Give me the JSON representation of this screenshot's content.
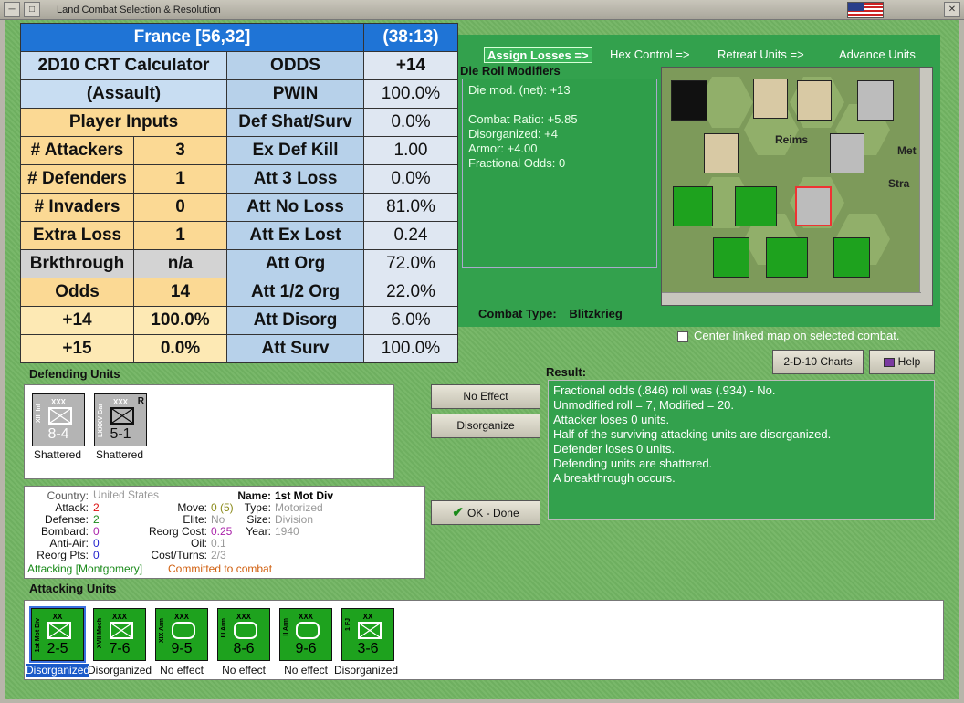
{
  "window": {
    "title": "Land Combat Selection & Resolution"
  },
  "crt": {
    "header_left": "France [56,32]",
    "header_right": "(38:13)",
    "calc_title": "2D10 CRT Calculator",
    "calc_sub": "(Assault)",
    "player_inputs": "Player Inputs",
    "rows_left": [
      {
        "label": "# Attackers",
        "value": "3"
      },
      {
        "label": "# Defenders",
        "value": "1"
      },
      {
        "label": "# Invaders",
        "value": "0"
      },
      {
        "label": "Extra Loss",
        "value": "1"
      },
      {
        "label": "Brkthrough",
        "value": "n/a"
      },
      {
        "label": "Odds",
        "value": "14"
      },
      {
        "label": "+14",
        "value": "100.0%"
      },
      {
        "label": "+15",
        "value": "0.0%"
      }
    ],
    "rows_right": [
      {
        "label": "ODDS",
        "value": "+14"
      },
      {
        "label": "PWIN",
        "value": "100.0%"
      },
      {
        "label": "Def Shat/Surv",
        "value": "0.0%"
      },
      {
        "label": "Ex Def Kill",
        "value": "1.00"
      },
      {
        "label": "Att 3 Loss",
        "value": "0.0%"
      },
      {
        "label": "Att No Loss",
        "value": "81.0%"
      },
      {
        "label": "Att Ex Lost",
        "value": "0.24"
      },
      {
        "label": "Att Org",
        "value": "72.0%"
      },
      {
        "label": "Att 1/2 Org",
        "value": "22.0%"
      },
      {
        "label": "Att Disorg",
        "value": "6.0%"
      },
      {
        "label": "Att Surv",
        "value": "100.0%"
      }
    ]
  },
  "steps": [
    "Assign Losses =>",
    "Hex Control =>",
    "Retreat Units =>",
    "Advance Units"
  ],
  "drm": {
    "title": "Die Roll Modifiers",
    "lines": [
      "Die mod. (net): +13",
      "",
      "Combat Ratio: +5.85",
      "Disorganized: +4",
      "Armor: +4.00",
      "Fractional Odds: 0"
    ]
  },
  "combat_type": {
    "label": "Combat Type:",
    "value": "Blitzkrieg"
  },
  "map": {
    "cities": [
      "Reims",
      "Met",
      "Stra"
    ]
  },
  "center_map_label": "Center linked map on selected combat.",
  "buttons": {
    "charts": "2-D-10 Charts",
    "help": "Help",
    "no_effect": "No Effect",
    "disorganize": "Disorganize",
    "ok_done": "OK - Done"
  },
  "defending": {
    "title": "Defending Units",
    "units": [
      {
        "size": "XXX",
        "name": "XIII Inf",
        "str": "8-4",
        "status": "Shattered"
      },
      {
        "size": "XXX",
        "name": "LXXXV Gar",
        "str": "5-1",
        "status": "Shattered",
        "tag": "R"
      }
    ]
  },
  "info": {
    "country_l": "Country:",
    "country_v": "United States",
    "attack_l": "Attack:",
    "attack_v": "2",
    "defense_l": "Defense:",
    "defense_v": "2",
    "bombard_l": "Bombard:",
    "bombard_v": "0",
    "antiair_l": "Anti-Air:",
    "antiair_v": "0",
    "reorg_l": "Reorg Pts:",
    "reorg_v": "0",
    "name_l": "Name:",
    "name_v": "1st Mot Div",
    "move_l": "Move:",
    "move_v": "0 (5)",
    "type_l": "Type:",
    "type_v": "Motorized",
    "elite_l": "Elite:",
    "elite_v": "No",
    "size_l": "Size:",
    "size_v": "Division",
    "reorgcost_l": "Reorg Cost:",
    "reorgcost_v": "0.25",
    "year_l": "Year:",
    "year_v": "1940",
    "oil_l": "Oil:",
    "oil_v": "0.1",
    "cost_l": "Cost/Turns:",
    "cost_v": "2/3",
    "status_a": "Attacking [Montgomery]",
    "status_b": "Committed to combat"
  },
  "result": {
    "title": "Result:",
    "lines": [
      "Fractional odds (.846) roll was (.934)  - No.",
      "Unmodified roll = 7, Modified = 20.",
      "Attacker loses 0 units.",
      "Half of the surviving attacking units are disorganized.",
      "Defender loses 0 units.",
      "Defending units are shattered.",
      "A breakthrough occurs."
    ]
  },
  "attacking": {
    "title": "Attacking Units",
    "units": [
      {
        "size": "XX",
        "name": "1st Mot Div",
        "str": "2-5",
        "status": "Disorganized"
      },
      {
        "size": "XXX",
        "name": "XVII Mech",
        "str": "7-6",
        "status": "Disorganized"
      },
      {
        "size": "XXX",
        "name": "XIX Arm",
        "str": "9-5",
        "status": "No effect"
      },
      {
        "size": "XXX",
        "name": "III Arm",
        "str": "8-6",
        "status": "No effect"
      },
      {
        "size": "XXX",
        "name": "II Arm",
        "str": "9-6",
        "status": "No effect"
      },
      {
        "size": "XX",
        "name": "1 FJ",
        "str": "3-6",
        "status": "Disorganized"
      }
    ]
  },
  "colors": {
    "panel_green": "#33a14d",
    "header_blue": "#1f74d6",
    "counter_green": "#1ea21e",
    "counter_gray": "#b4b4b4"
  }
}
